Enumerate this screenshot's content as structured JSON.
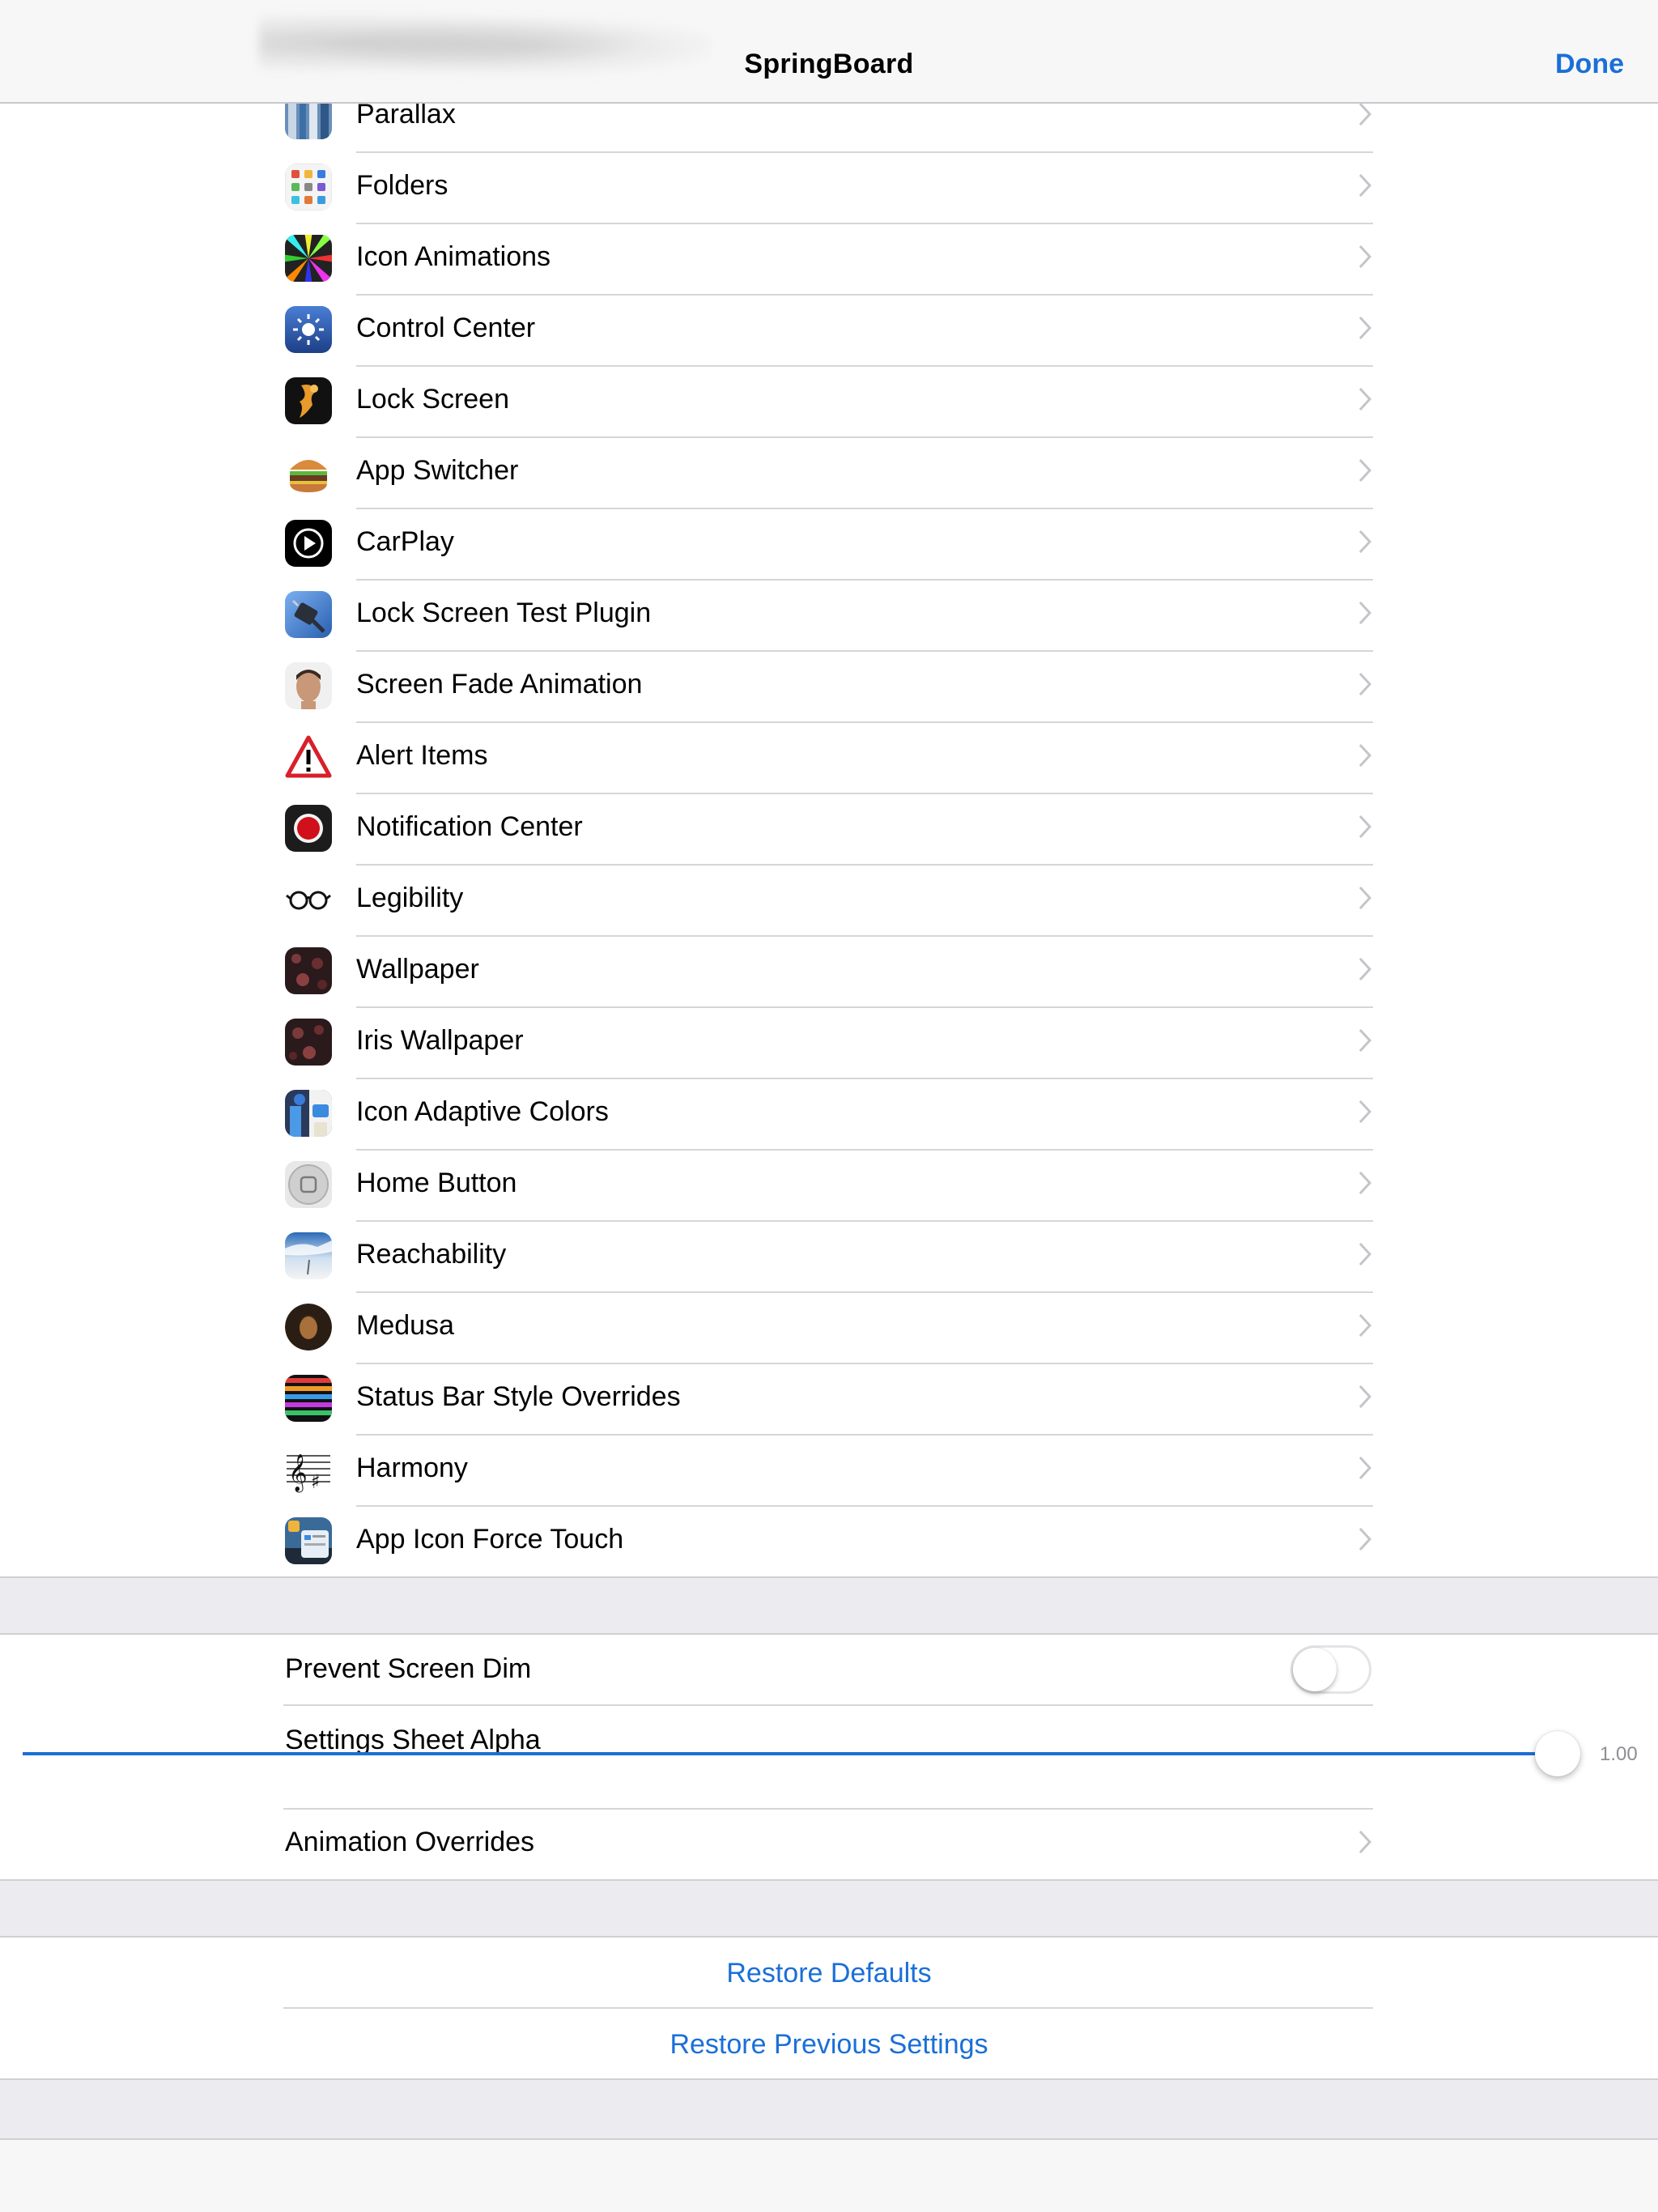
{
  "nav": {
    "title": "SpringBoard",
    "done_label": "Done"
  },
  "items": [
    {
      "label": "Parallax",
      "icon": "parallax-icon"
    },
    {
      "label": "Folders",
      "icon": "folders-icon"
    },
    {
      "label": "Icon Animations",
      "icon": "icon-animations-icon"
    },
    {
      "label": "Control Center",
      "icon": "control-center-icon"
    },
    {
      "label": "Lock Screen",
      "icon": "lock-screen-icon"
    },
    {
      "label": "App Switcher",
      "icon": "burger-icon"
    },
    {
      "label": "CarPlay",
      "icon": "carplay-icon"
    },
    {
      "label": "Lock Screen Test Plugin",
      "icon": "plug-icon"
    },
    {
      "label": "Screen Fade Animation",
      "icon": "face-icon"
    },
    {
      "label": "Alert Items",
      "icon": "warning-icon"
    },
    {
      "label": "Notification Center",
      "icon": "record-icon"
    },
    {
      "label": "Legibility",
      "icon": "glasses-icon"
    },
    {
      "label": "Wallpaper",
      "icon": "wallpaper-icon"
    },
    {
      "label": "Iris Wallpaper",
      "icon": "iris-wallpaper-icon"
    },
    {
      "label": "Icon Adaptive Colors",
      "icon": "adaptive-colors-icon"
    },
    {
      "label": "Home Button",
      "icon": "home-button-icon"
    },
    {
      "label": "Reachability",
      "icon": "reachability-icon"
    },
    {
      "label": "Medusa",
      "icon": "medusa-icon"
    },
    {
      "label": "Status Bar Style Overrides",
      "icon": "status-bar-icon"
    },
    {
      "label": "Harmony",
      "icon": "music-notes-icon"
    },
    {
      "label": "App Icon Force Touch",
      "icon": "force-touch-icon"
    }
  ],
  "settings": {
    "prevent_dim_label": "Prevent Screen Dim",
    "prevent_dim_on": false,
    "sheet_alpha_label": "Settings Sheet Alpha",
    "sheet_alpha_value": "1.00",
    "animation_overrides_label": "Animation Overrides"
  },
  "actions": {
    "restore_defaults": "Restore Defaults",
    "restore_previous": "Restore Previous Settings"
  },
  "colors": {
    "accent": "#1a6fd8",
    "group_bg": "#ebebf0",
    "separator": "#d6d6d9"
  }
}
